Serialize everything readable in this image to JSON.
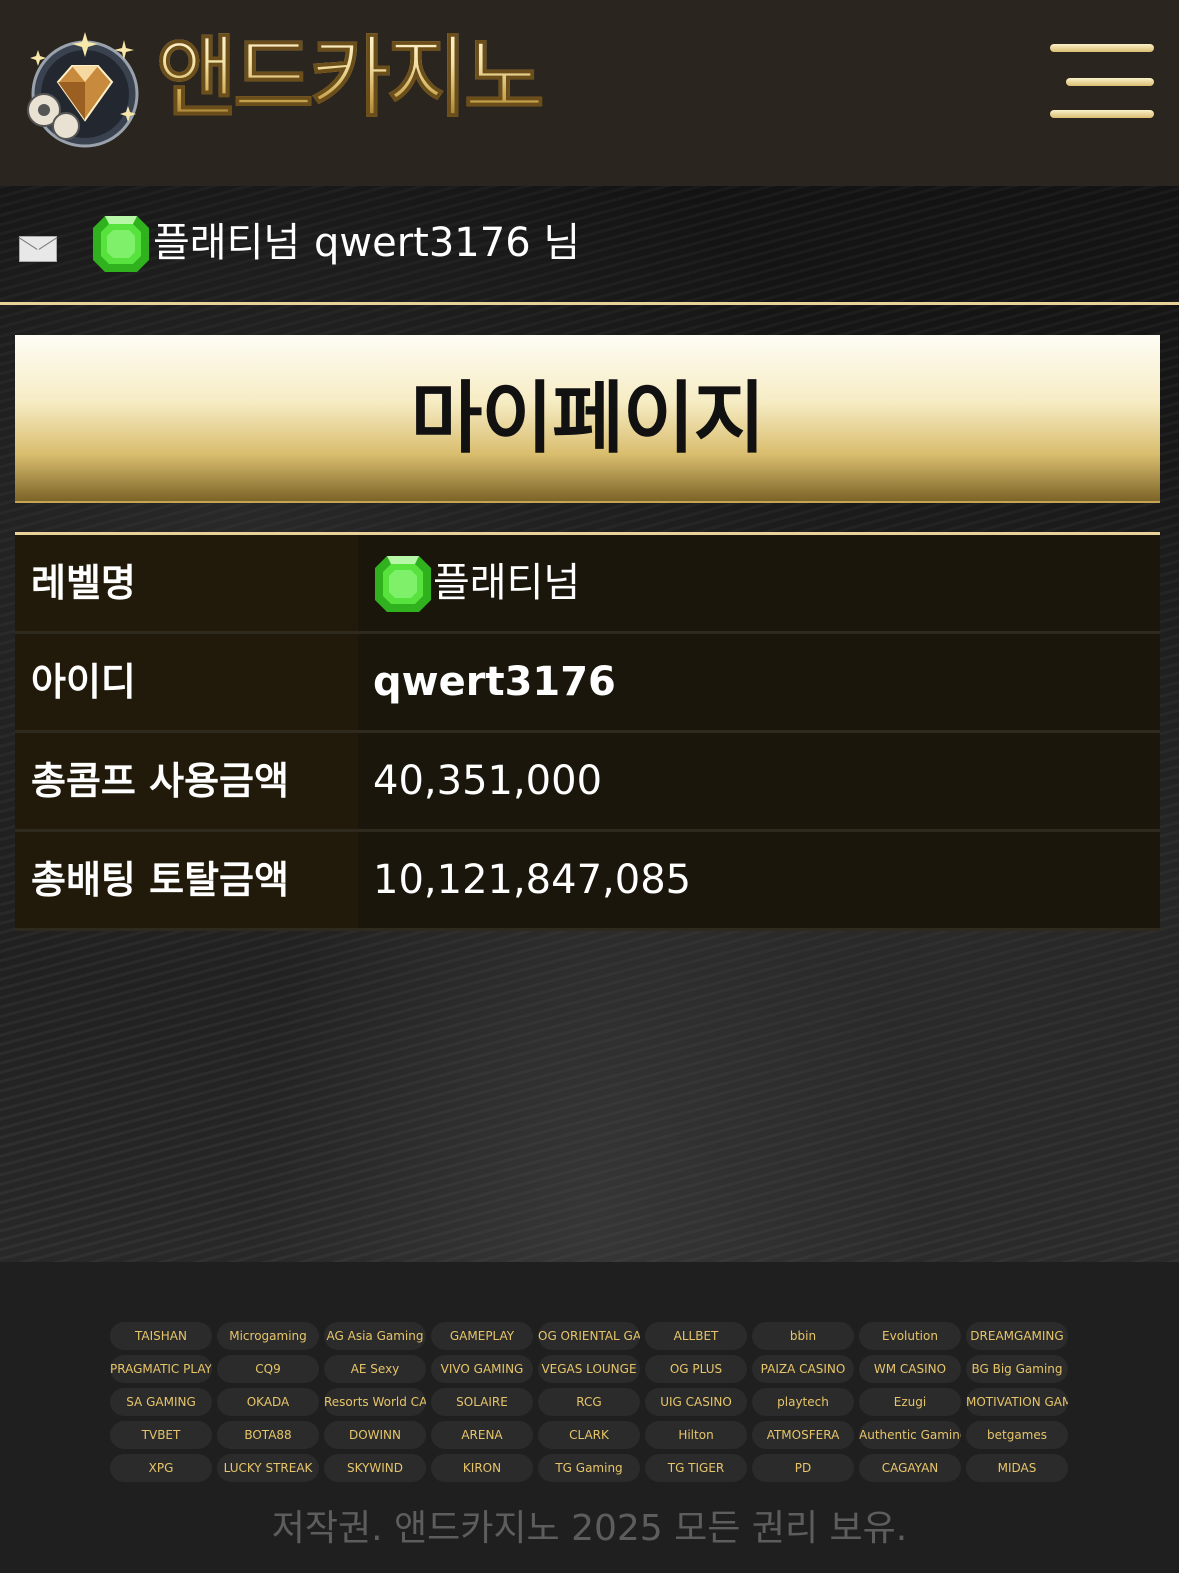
{
  "header": {
    "logo_text": "앤드카지노",
    "menu_icon": "hamburger-menu-icon"
  },
  "user": {
    "mail_icon": "envelope-icon",
    "level_icon": "green-gem-icon",
    "level": "플래티넘",
    "greeting": "qwert3176 님"
  },
  "page": {
    "title": "마이페이지"
  },
  "info": {
    "rows": [
      {
        "label": "레벨명",
        "value": "플래티넘"
      },
      {
        "label": "아이디",
        "value": "qwert3176"
      },
      {
        "label": "총콤프 사용금액",
        "value": "40,351,000"
      },
      {
        "label": "총배팅 토탈금액",
        "value": "10,121,847,085"
      }
    ]
  },
  "footer": {
    "providers": [
      "TAISHAN",
      "Microgaming",
      "AG Asia Gaming",
      "GAMEPLAY",
      "OG ORIENTAL GAME",
      "ALLBET",
      "bbin",
      "Evolution",
      "DREAMGAMING",
      "PRAGMATIC PLAY",
      "CQ9",
      "AE Sexy",
      "VIVO GAMING",
      "VEGAS LOUNGE",
      "OG PLUS",
      "PAIZA CASINO",
      "WM CASINO",
      "BG Big Gaming",
      "SA GAMING",
      "OKADA",
      "Resorts World CASINO",
      "SOLAIRE",
      "RCG",
      "UIG CASINO",
      "playtech",
      "Ezugi",
      "MOTIVATION GAMING",
      "TVBET",
      "BOTA88",
      "DOWINN",
      "ARENA",
      "CLARK",
      "Hilton",
      "ATMOSFERA",
      "Authentic Gaming",
      "betgames",
      "XPG",
      "LUCKY STREAK",
      "SKYWIND",
      "KIRON",
      "TG Gaming",
      "TG TIGER",
      "PD",
      "CAGAYAN",
      "MIDAS"
    ],
    "copyright": "저작권. 앤드카지노 2025 모든 권리 보유."
  },
  "colors": {
    "gold": "#e9d29a",
    "header_bg": "#2a251f",
    "footer_bg": "#1f1f1f",
    "gem": "#3fd12a"
  }
}
